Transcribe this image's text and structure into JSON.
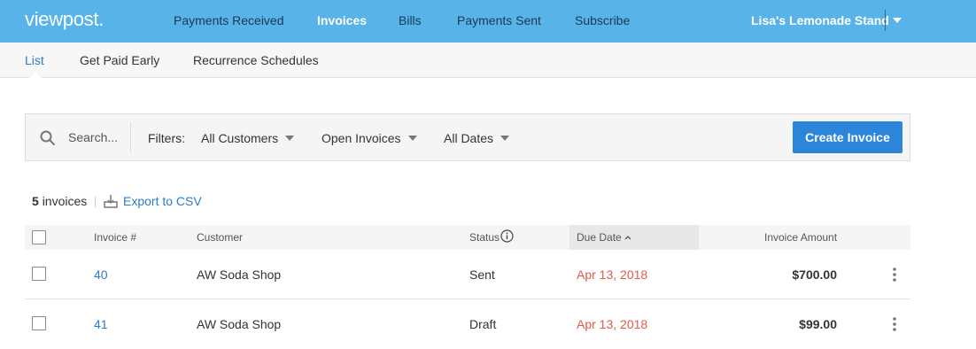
{
  "brand": {
    "logo": "viewpost"
  },
  "nav": {
    "items": [
      {
        "label": "Payments Received"
      },
      {
        "label": "Invoices"
      },
      {
        "label": "Bills"
      },
      {
        "label": "Payments Sent"
      },
      {
        "label": "Subscribe"
      }
    ],
    "active_index": 1,
    "account": "Lisa's Lemonade Stand"
  },
  "subnav": {
    "items": [
      {
        "label": "List"
      },
      {
        "label": "Get Paid Early"
      },
      {
        "label": "Recurrence Schedules"
      }
    ],
    "active_index": 0
  },
  "filterbar": {
    "search_placeholder": "Search...",
    "filters_label": "Filters:",
    "customer_filter": "All Customers",
    "invoice_filter": "Open Invoices",
    "date_filter": "All Dates",
    "create_button": "Create Invoice"
  },
  "summary": {
    "count": "5",
    "count_label": "invoices",
    "separator": "|",
    "export_label": "Export to CSV"
  },
  "table": {
    "columns": {
      "invoice": "Invoice #",
      "customer": "Customer",
      "status": "Status",
      "due_date": "Due Date",
      "amount": "Invoice Amount"
    },
    "sorted_column": "due_date",
    "sort_direction": "ascending",
    "rows": [
      {
        "invoice": "40",
        "customer": "AW Soda Shop",
        "status": "Sent",
        "due_date": "Apr 13, 2018",
        "amount": "$700.00"
      },
      {
        "invoice": "41",
        "customer": "AW Soda Shop",
        "status": "Draft",
        "due_date": "Apr 13, 2018",
        "amount": "$99.00"
      }
    ]
  },
  "colors": {
    "topnav_bg": "#57b3e8",
    "accent_link": "#2b7cc9",
    "primary_button": "#2b85d9",
    "overdue_date": "#e05a48"
  },
  "icons": {
    "search": "search-icon",
    "export": "download-tray-icon",
    "status_info": "info-circle-icon",
    "sort": "chevron-up-icon",
    "row_actions": "kebab-menu-icon",
    "account_menu": "caret-down-icon"
  }
}
